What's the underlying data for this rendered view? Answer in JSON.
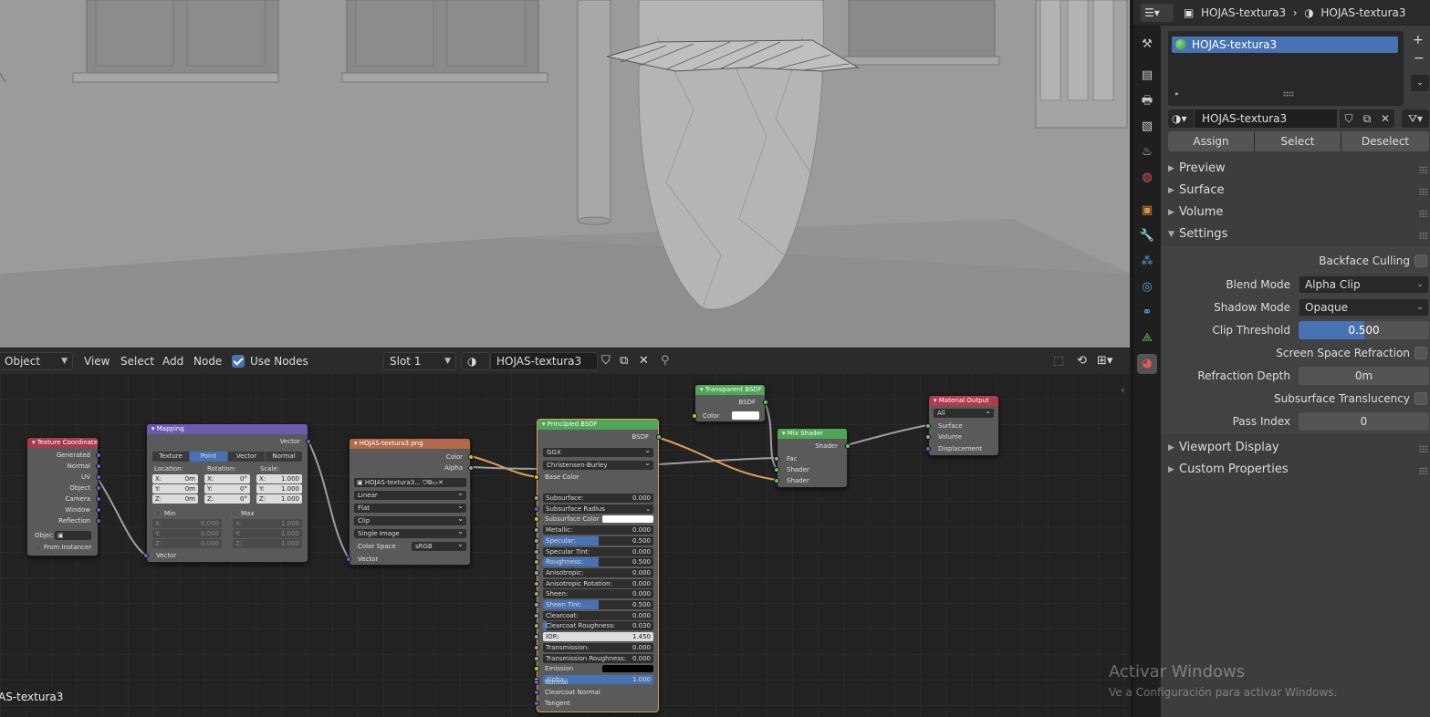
{
  "viewport": {
    "overlay_name": "AS-textura3"
  },
  "node_editor": {
    "header": {
      "mode": "Object",
      "menu": [
        "View",
        "Select",
        "Add",
        "Node"
      ],
      "use_nodes_label": "Use Nodes",
      "use_nodes_checked": true,
      "slot": "Slot 1",
      "material_name": "HOJAS-textura3"
    },
    "nodes": {
      "texcoord": {
        "title": "Texture Coordinate",
        "outputs": [
          "Generated",
          "Normal",
          "UV",
          "Object",
          "Camera",
          "Window",
          "Reflection"
        ],
        "object_label": "Objec",
        "from_instancer": "From Instancer"
      },
      "mapping": {
        "title": "Mapping",
        "output": "Vector",
        "types": [
          "Texture",
          "Point",
          "Vector",
          "Normal"
        ],
        "active_type": "Point",
        "col_headers": [
          "Location:",
          "Rotation:",
          "Scale:"
        ],
        "location": [
          {
            "axis": "X:",
            "val": "0m"
          },
          {
            "axis": "Y:",
            "val": "0m"
          },
          {
            "axis": "Z:",
            "val": "0m"
          }
        ],
        "rotation": [
          {
            "axis": "X:",
            "val": "0°"
          },
          {
            "axis": "Y:",
            "val": "0°"
          },
          {
            "axis": "Z:",
            "val": "0°"
          }
        ],
        "scale": [
          {
            "axis": "X:",
            "val": "1.000"
          },
          {
            "axis": "Y:",
            "val": "1.000"
          },
          {
            "axis": "Z:",
            "val": "1.000"
          }
        ],
        "min_label": "Min",
        "max_label": "Max",
        "min": [
          {
            "axis": "X:",
            "val": "0.000"
          },
          {
            "axis": "Y:",
            "val": "0.000"
          },
          {
            "axis": "Z:",
            "val": "0.000"
          }
        ],
        "max": [
          {
            "axis": "X:",
            "val": "1.000"
          },
          {
            "axis": "Y:",
            "val": "1.000"
          },
          {
            "axis": "Z:",
            "val": "1.000"
          }
        ],
        "input": "Vector"
      },
      "image": {
        "title": "HOJAS-textura3.png",
        "outputs": [
          "Color",
          "Alpha"
        ],
        "image_name": "HOJAS-textura3...",
        "interpolation": "Linear",
        "projection": "Flat",
        "extension": "Clip",
        "source": "Single Image",
        "color_space_label": "Color Space",
        "color_space": "sRGB",
        "input": "Vector"
      },
      "principled": {
        "title": "Principled BSDF",
        "output": "BSDF",
        "distribution": "GGX",
        "subsurface_method": "Christensen-Burley",
        "base_color": "Base Color",
        "fields": [
          {
            "label": "Subsurface:",
            "val": "0.000",
            "fill": 0
          },
          {
            "label": "Subsurface Radius",
            "val": "",
            "fill": 0,
            "dropdown": true
          },
          {
            "label": "Subsurface Color",
            "val": "",
            "fill": 0,
            "swatch": "#ffffff"
          },
          {
            "label": "Metallic:",
            "val": "0.000",
            "fill": 0
          },
          {
            "label": "Specular:",
            "val": "0.500",
            "fill": 0.5
          },
          {
            "label": "Specular Tint:",
            "val": "0.000",
            "fill": 0
          },
          {
            "label": "Roughness:",
            "val": "0.500",
            "fill": 0.5
          },
          {
            "label": "Anisotropic:",
            "val": "0.000",
            "fill": 0
          },
          {
            "label": "Anisotropic Rotation:",
            "val": "0.000",
            "fill": 0
          },
          {
            "label": "Sheen:",
            "val": "0.000",
            "fill": 0
          },
          {
            "label": "Sheen Tint:",
            "val": "0.500",
            "fill": 0.5
          },
          {
            "label": "Clearcoat:",
            "val": "0.000",
            "fill": 0
          },
          {
            "label": "Clearcoat Roughness:",
            "val": "0.030",
            "fill": 0.03
          },
          {
            "label": "IOR:",
            "val": "1.450",
            "fill": 0,
            "light": true
          },
          {
            "label": "Transmission:",
            "val": "0.000",
            "fill": 0
          },
          {
            "label": "Transmission Roughness:",
            "val": "0.000",
            "fill": 0
          },
          {
            "label": "Emission",
            "val": "",
            "fill": 0,
            "swatch": "#000000"
          },
          {
            "label": "Alpha:",
            "val": "1.000",
            "fill": 1
          }
        ],
        "vector_inputs": [
          "Normal",
          "Clearcoat Normal",
          "Tangent"
        ]
      },
      "transparent": {
        "title": "Transparent BSDF",
        "output": "BSDF",
        "color_label": "Color"
      },
      "mix": {
        "title": "Mix Shader",
        "output": "Shader",
        "inputs": [
          "Fac",
          "Shader",
          "Shader"
        ]
      },
      "output": {
        "title": "Material Output",
        "target": "All",
        "inputs": [
          "Surface",
          "Volume",
          "Displacement"
        ]
      }
    }
  },
  "properties": {
    "breadcrumb": [
      "HOJAS-textura3",
      "HOJAS-textura3"
    ],
    "slot_item": "HOJAS-textura3",
    "material_name": "HOJAS-textura3",
    "assign_buttons": [
      "Assign",
      "Select",
      "Deselect"
    ],
    "panels": [
      "Preview",
      "Surface",
      "Volume",
      "Settings"
    ],
    "settings": {
      "backface_culling": "Backface Culling",
      "blend_mode_label": "Blend Mode",
      "blend_mode": "Alpha Clip",
      "shadow_mode_label": "Shadow Mode",
      "shadow_mode": "Opaque",
      "clip_threshold_label": "Clip Threshold",
      "clip_threshold": "0.500",
      "clip_threshold_fill": 0.5,
      "ssr": "Screen Space Refraction",
      "refraction_depth_label": "Refraction Depth",
      "refraction_depth": "0m",
      "subsurface_translucency": "Subsurface Translucency",
      "pass_index_label": "Pass Index",
      "pass_index": "0"
    },
    "bottom_panels": [
      "Viewport Display",
      "Custom Properties"
    ]
  },
  "watermark": {
    "line1": "Activar Windows",
    "line2": "Ve a Configuración para activar Windows."
  },
  "colors": {
    "accent": "#4772b3",
    "texcoord_header": "#a83a4e",
    "mapping_header": "#6c5ab0",
    "image_header": "#b3694a",
    "shader_header": "#4fa656",
    "output_header": "#b33a4e"
  }
}
